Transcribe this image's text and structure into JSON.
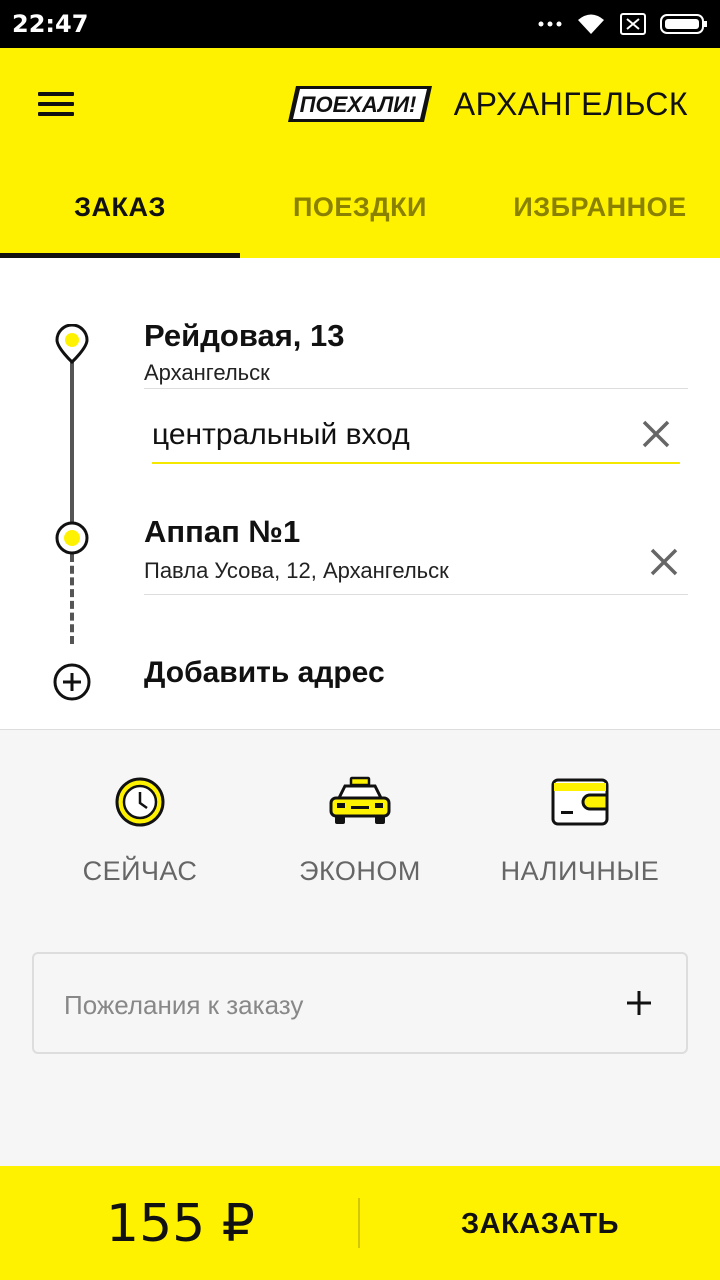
{
  "statusbar": {
    "time": "22:47",
    "icons": [
      "dots-icon",
      "wifi-icon",
      "sim-off-icon",
      "battery-icon"
    ]
  },
  "header": {
    "logo_text": "ПОЕХАЛИ!",
    "city": "АРХАНГЕЛЬСК",
    "tabs": [
      {
        "label": "ЗАКАЗ",
        "active": true
      },
      {
        "label": "ПОЕЗДКИ",
        "active": false
      },
      {
        "label": "ИЗБРАННОЕ",
        "active": false
      }
    ]
  },
  "route": {
    "from": {
      "title": "Рейдовая, 13",
      "subtitle": "Архангельск",
      "entrance": "центральный вход"
    },
    "to": {
      "title": "Аппап №1",
      "subtitle": "Павла Усова, 12, Архангельск"
    },
    "add_label": "Добавить адрес"
  },
  "options": {
    "time_label": "СЕЙЧАС",
    "tariff_label": "ЭКОНОМ",
    "payment_label": "НАЛИЧНЫЕ"
  },
  "wishes": {
    "placeholder": "Пожелания к заказу"
  },
  "bottom": {
    "price": "155 ₽",
    "order_label": "ЗАКАЗАТЬ"
  },
  "colors": {
    "accent": "#fff200",
    "text": "#111111",
    "muted": "#666666"
  }
}
